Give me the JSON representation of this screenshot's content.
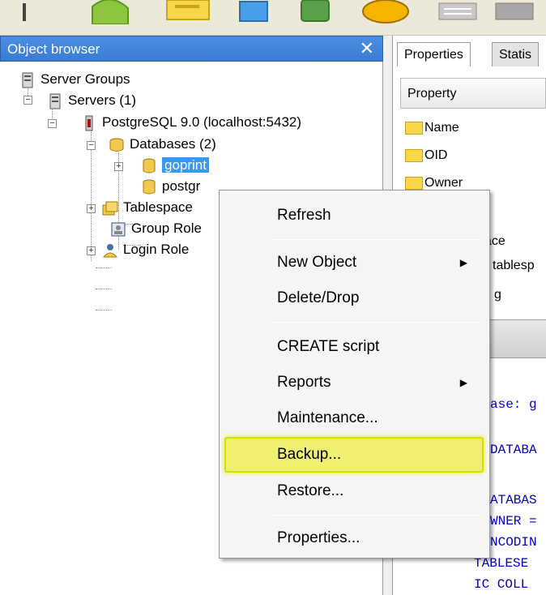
{
  "toolbar": {
    "icons": [
      "plug-icon",
      "refresh-icon",
      "properties-icon",
      "create-icon",
      "delete-icon",
      "sql-icon",
      "view-data-icon",
      "filter-icon"
    ]
  },
  "object_browser": {
    "title": "Object browser",
    "tree": {
      "server_groups": "Server Groups",
      "servers": "Servers (1)",
      "postgres_server": "PostgreSQL 9.0 (localhost:5432)",
      "databases": "Databases (2)",
      "db_goprint": "goprint",
      "db_postgres": "postgr",
      "tablespaces": "Tablespace",
      "group_roles": "Group Role",
      "login_roles": "Login Role"
    }
  },
  "right_panel": {
    "tabs": [
      "Properties",
      "Statis"
    ],
    "property_header": "Property",
    "properties": [
      "Name",
      "OID",
      "Owner",
      "ace",
      "tablesp",
      "g"
    ],
    "sql_lines": [
      "ase: g",
      "DATABA",
      "ATABAS",
      "WNER =",
      "NCODIN",
      "TABLESE",
      "IC COLL"
    ]
  },
  "context_menu": {
    "items": [
      {
        "label": "Refresh"
      },
      {
        "label": "New Object"
      },
      {
        "label": "Delete/Drop"
      },
      {
        "label": "CREATE script"
      },
      {
        "label": "Reports"
      },
      {
        "label": "Maintenance..."
      },
      {
        "label": "Backup..."
      },
      {
        "label": "Restore..."
      },
      {
        "label": "Properties..."
      }
    ]
  },
  "colors": {
    "title_bar": "#3a7bd5",
    "selection": "#3399ff",
    "highlight": "#f0f070"
  }
}
